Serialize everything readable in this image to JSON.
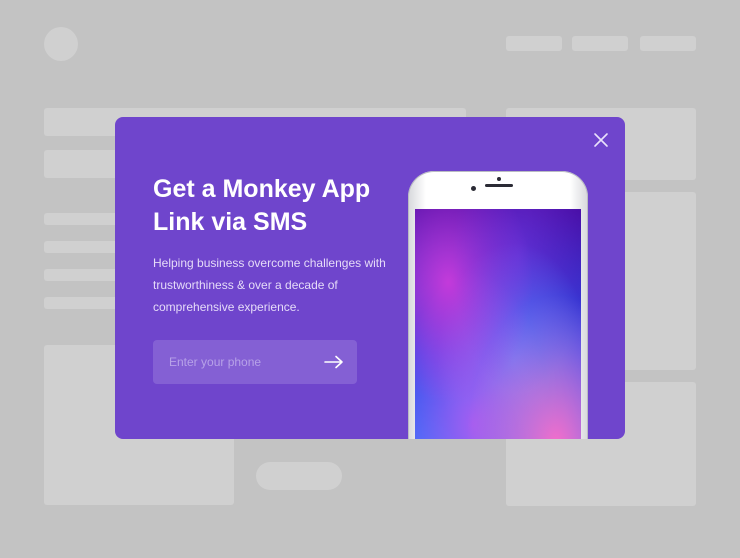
{
  "modal": {
    "title": "Get a Monkey App Link via SMS",
    "description": "Helping business overcome challenges with trustworthiness & over a decade of comprehensive experience.",
    "phone_input": {
      "placeholder": "Enter your phone",
      "value": ""
    },
    "icons": {
      "close": "close-icon",
      "submit": "arrow-right-icon"
    }
  },
  "colors": {
    "backdrop": "#c3c3c3",
    "modal_bg": "#6f45cc",
    "input_bg": "#8460d4",
    "text": "#ffffff"
  }
}
